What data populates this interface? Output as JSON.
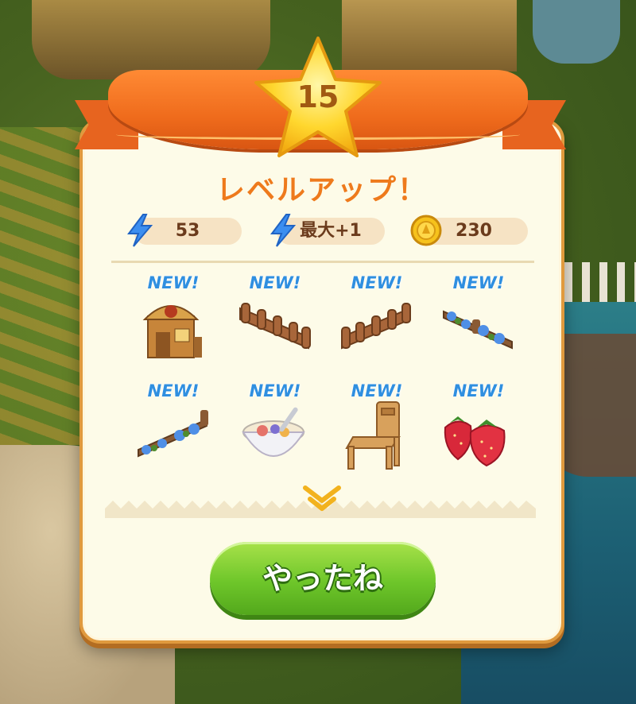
{
  "dialog": {
    "level": "15",
    "title": "レベルアップ！",
    "stats": [
      {
        "icon": "energy-bolt-icon",
        "value": "53"
      },
      {
        "icon": "energy-bolt-icon",
        "value": "最大+1"
      },
      {
        "icon": "gold-coin-icon",
        "value": "230"
      }
    ],
    "rewards": [
      {
        "badge": "NEW!",
        "item": "wooden-shop-building"
      },
      {
        "badge": "NEW!",
        "item": "wooden-fence-left"
      },
      {
        "badge": "NEW!",
        "item": "wooden-fence-right"
      },
      {
        "badge": "NEW!",
        "item": "flower-fence-right"
      },
      {
        "badge": "NEW!",
        "item": "flower-fence-left"
      },
      {
        "badge": "NEW!",
        "item": "fruit-bowl"
      },
      {
        "badge": "NEW!",
        "item": "wooden-chair"
      },
      {
        "badge": "NEW!",
        "item": "strawberries"
      }
    ],
    "confirm_button": "やったね"
  },
  "colors": {
    "ribbon": "#ef6b1c",
    "title": "#ee7a1c",
    "new_badge": "#2f8fe0",
    "button": "#6ec62a",
    "panel": "#fdfbe8"
  }
}
